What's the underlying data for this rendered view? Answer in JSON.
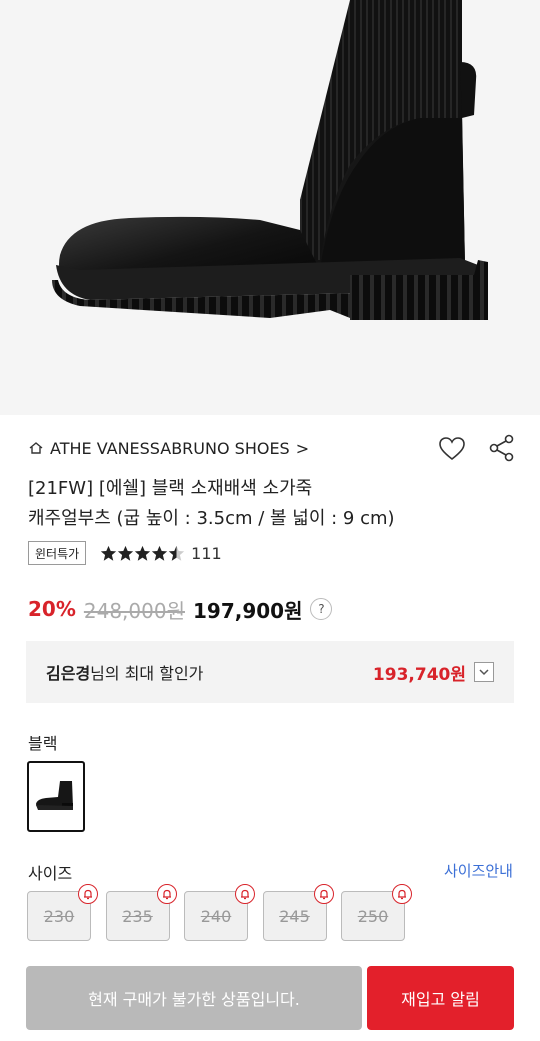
{
  "product": {
    "brand": "ATHE VANESSABRUNO SHOES",
    "brand_chevron": ">",
    "title_line1": "[21FW] [에쉘] 블랙 소재배색 소가죽",
    "title_line2": "캐주얼부츠 (굽 높이 : 3.5cm / 볼 넓이 : 9 cm)",
    "badge": "윈터특가",
    "rating": 4.5,
    "review_count": "111",
    "discount_pct": "20%",
    "original_price": "248,000원",
    "sale_price": "197,900원",
    "price_help": "?"
  },
  "max_discount": {
    "user_name": "김은경",
    "label_suffix": "님의 최대 할인가",
    "amount": "193,740원"
  },
  "color": {
    "label": "블랙"
  },
  "size": {
    "label": "사이즈",
    "guide": "사이즈안내",
    "options": [
      "230",
      "235",
      "240",
      "245",
      "250"
    ]
  },
  "actions": {
    "unavailable": "현재 구매가 불가한 상품입니다.",
    "restock_notify": "재입고 알림"
  },
  "colors": {
    "accent_red": "#d8232a",
    "link_blue": "#3b6fd6"
  }
}
